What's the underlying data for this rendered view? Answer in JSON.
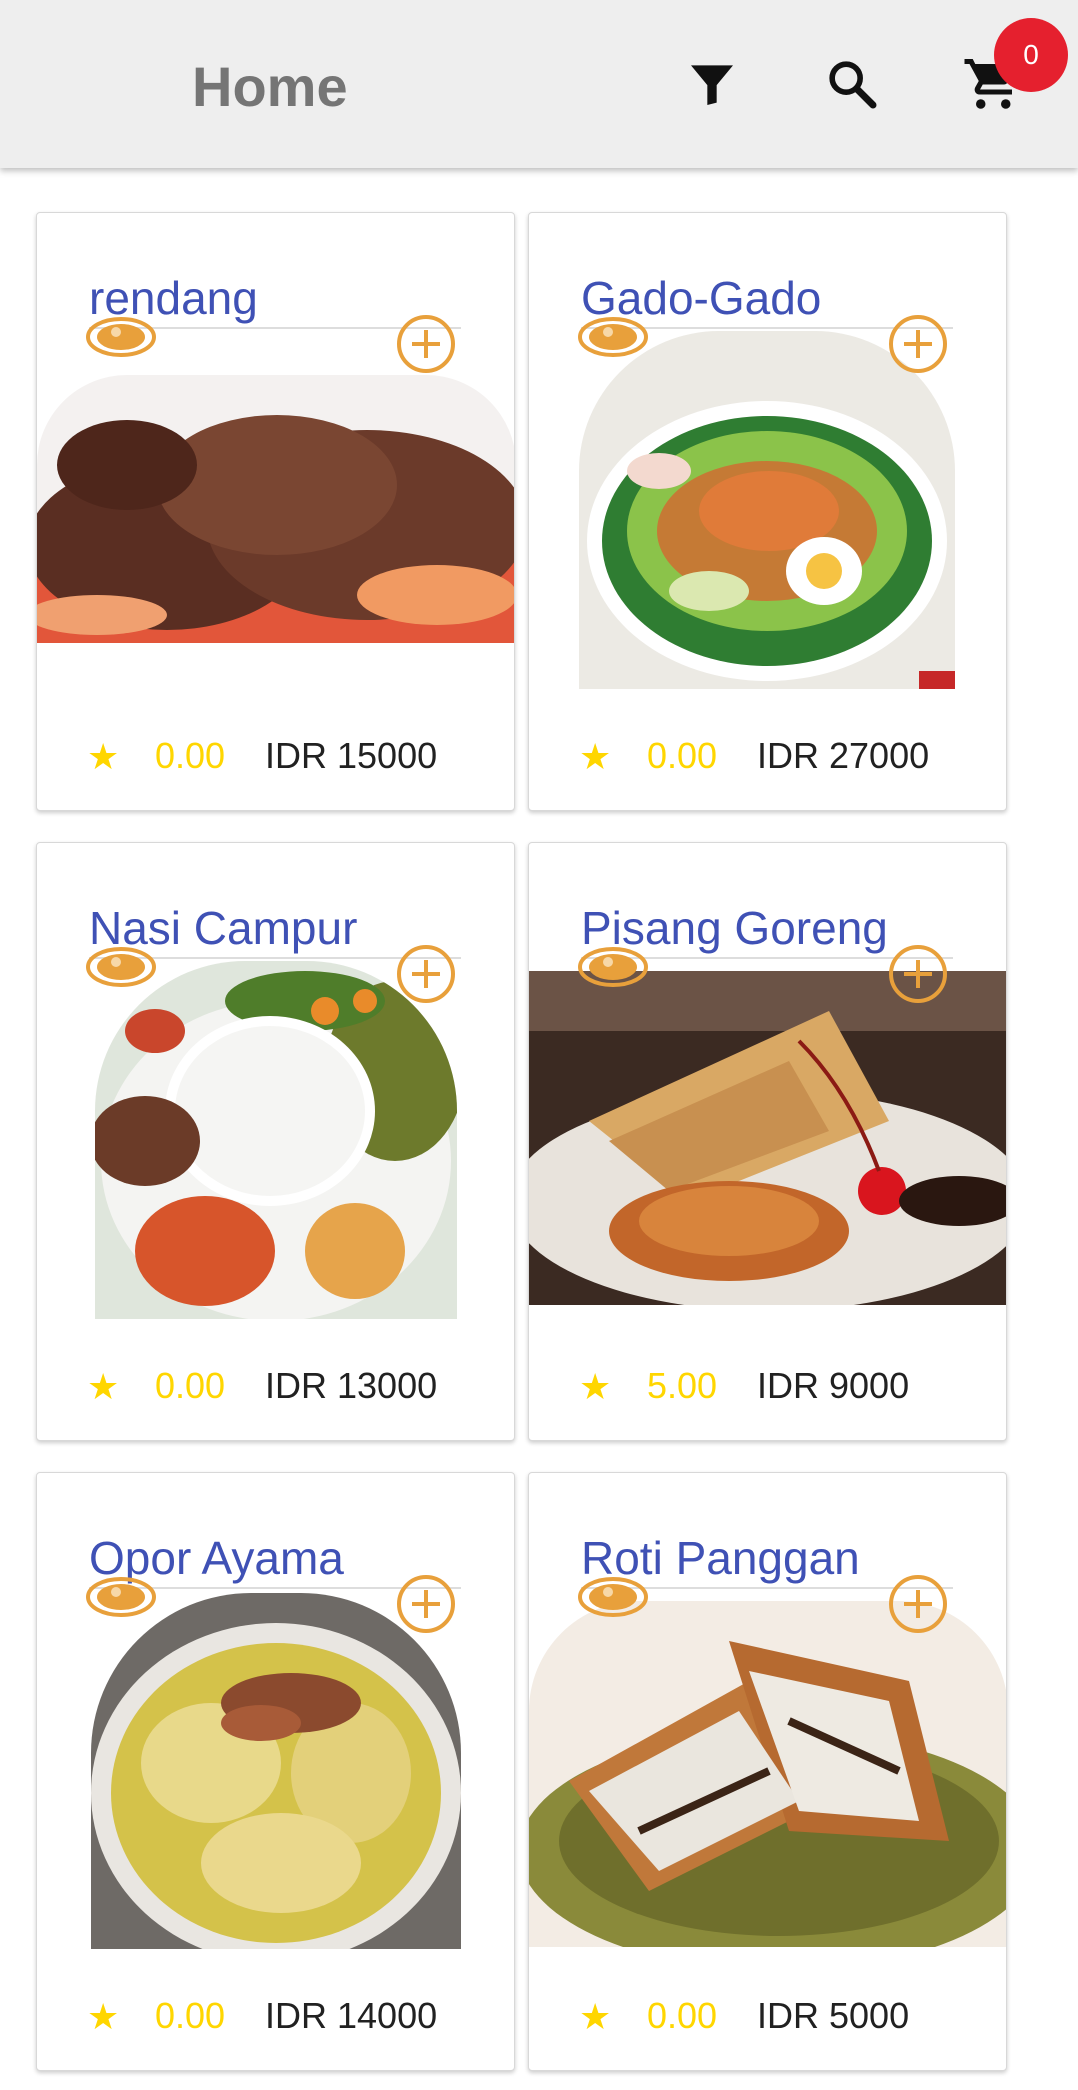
{
  "header": {
    "title": "Home",
    "cart_count": "0",
    "icons": [
      "filter-icon",
      "search-icon",
      "cart-icon"
    ]
  },
  "colors": {
    "app_bar": "#eeeeee",
    "title": "#757575",
    "product_name": "#3f51b5",
    "accent_orange": "#e8a03b",
    "rating": "#ffd600",
    "badge": "#e5202e"
  },
  "products": [
    {
      "name": "rendang",
      "rating": "0.00",
      "price": "IDR 15000",
      "photo": "rendang"
    },
    {
      "name": "Gado-Gado",
      "rating": "0.00",
      "price": "IDR 27000",
      "photo": "gado-gado"
    },
    {
      "name": "Nasi Campur",
      "rating": "0.00",
      "price": "IDR 13000",
      "photo": "nasi-campur"
    },
    {
      "name": "Pisang Goreng",
      "rating": "5.00",
      "price": "IDR 9000",
      "photo": "pisang-goreng"
    },
    {
      "name": "Opor Ayama",
      "rating": "0.00",
      "price": "IDR 14000",
      "photo": "opor-ayam"
    },
    {
      "name": "Roti Panggan",
      "rating": "0.00",
      "price": "IDR 5000",
      "photo": "roti-panggang"
    }
  ]
}
